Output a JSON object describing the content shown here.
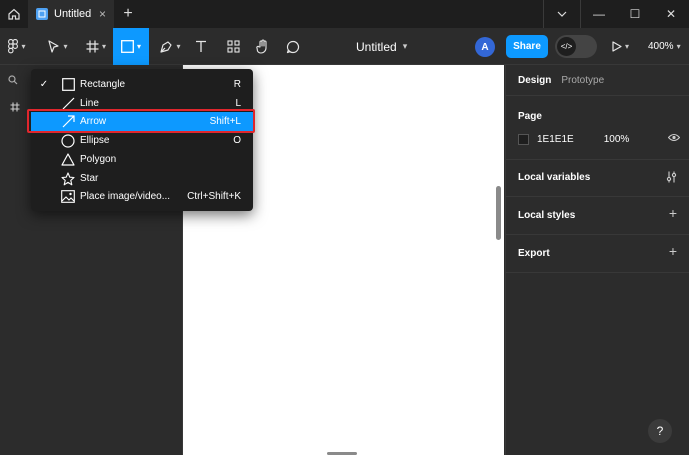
{
  "titlebar": {
    "tab_title": "Untitled",
    "tab_close": "×",
    "new_tab": "+",
    "minimize": "—",
    "maximize": "☐",
    "close": "✕"
  },
  "toolbar": {
    "doc_title": "Untitled",
    "doc_caret": "⌄",
    "avatar_initial": "A",
    "share_label": "Share",
    "dev_mode_glyph": "</>",
    "zoom_label": "400%"
  },
  "menu": {
    "items": [
      {
        "label": "Rectangle",
        "shortcut": "R",
        "checked": true,
        "icon": "rectangle-icon"
      },
      {
        "label": "Line",
        "shortcut": "L",
        "checked": false,
        "icon": "line-icon"
      },
      {
        "label": "Arrow",
        "shortcut": "Shift+L",
        "checked": false,
        "icon": "arrow-icon"
      },
      {
        "label": "Ellipse",
        "shortcut": "O",
        "checked": false,
        "icon": "ellipse-icon"
      },
      {
        "label": "Polygon",
        "shortcut": "",
        "checked": false,
        "icon": "polygon-icon"
      },
      {
        "label": "Star",
        "shortcut": "",
        "checked": false,
        "icon": "star-icon"
      },
      {
        "label": "Place image/video...",
        "shortcut": "Ctrl+Shift+K",
        "checked": false,
        "icon": "image-icon"
      }
    ],
    "check_glyph": "✓"
  },
  "rightpanel": {
    "tab_design": "Design",
    "tab_prototype": "Prototype",
    "page_title": "Page",
    "page_color": "1E1E1E",
    "page_opacity": "100%",
    "local_variables": "Local variables",
    "local_styles": "Local styles",
    "export": "Export",
    "plus": "+"
  },
  "help": "?",
  "colors": {
    "accent": "#0d99ff",
    "highlight_border": "#e0262d",
    "panel_bg": "#2c2c2c",
    "menu_bg": "#1e1e1e"
  }
}
